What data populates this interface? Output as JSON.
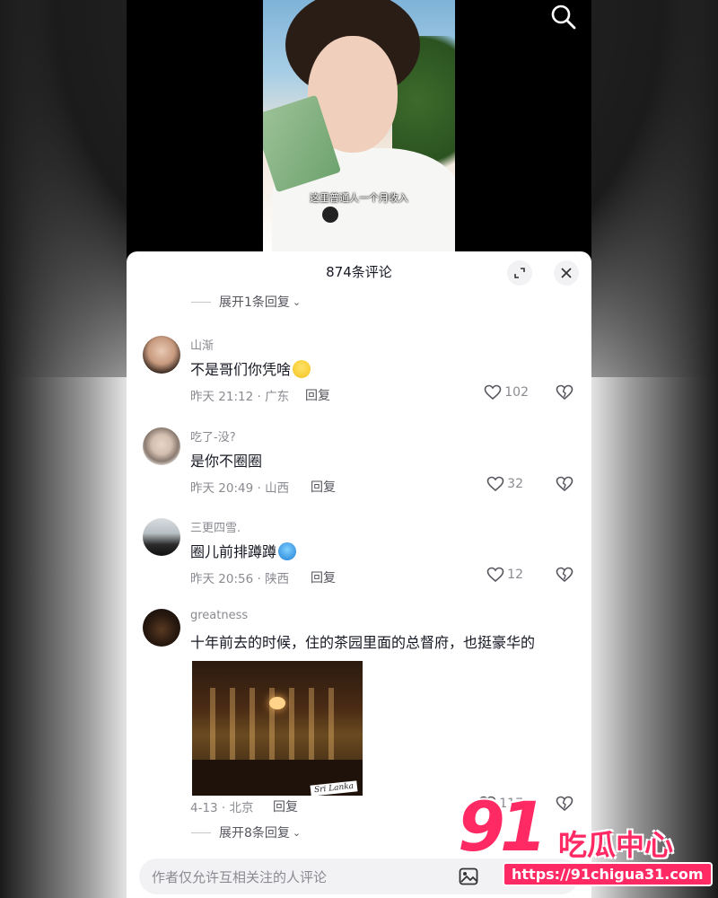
{
  "video": {
    "subtitle": "这里普通人一个月收入"
  },
  "sheet": {
    "title": "874条评论"
  },
  "top_replies_toggle": "展开1条回复",
  "comments": [
    {
      "user": "山渐",
      "text": "不是哥们你凭啥",
      "meta": "昨天 21:12 · 广东",
      "reply": "回复",
      "likes": "102"
    },
    {
      "user": "吃了-没?",
      "text": "是你不圈圈",
      "meta": "昨天 20:49 · 山西",
      "reply": "回复",
      "likes": "32"
    },
    {
      "user": "三更四雪.",
      "text": "圈儿前排蹲蹲",
      "meta": "昨天 20:56 · 陕西",
      "reply": "回复",
      "likes": "12"
    },
    {
      "user": "greatness",
      "text": "十年前去的时候，住的茶园里面的总督府，也挺豪华的",
      "meta": "4-13 · 北京",
      "reply": "回复",
      "likes": "117",
      "photo_caption": "Sri Lanka"
    }
  ],
  "bottom_replies_toggle": "展开8条回复",
  "input": {
    "placeholder": "作者仅允许互相关注的人评论"
  },
  "watermark": {
    "number": "91",
    "name": "吃瓜中心",
    "url": "https://91chigua31.com"
  },
  "colors": {
    "accent": "#ff2a64",
    "text_primary": "#161823",
    "text_secondary": "#8a8b91"
  }
}
